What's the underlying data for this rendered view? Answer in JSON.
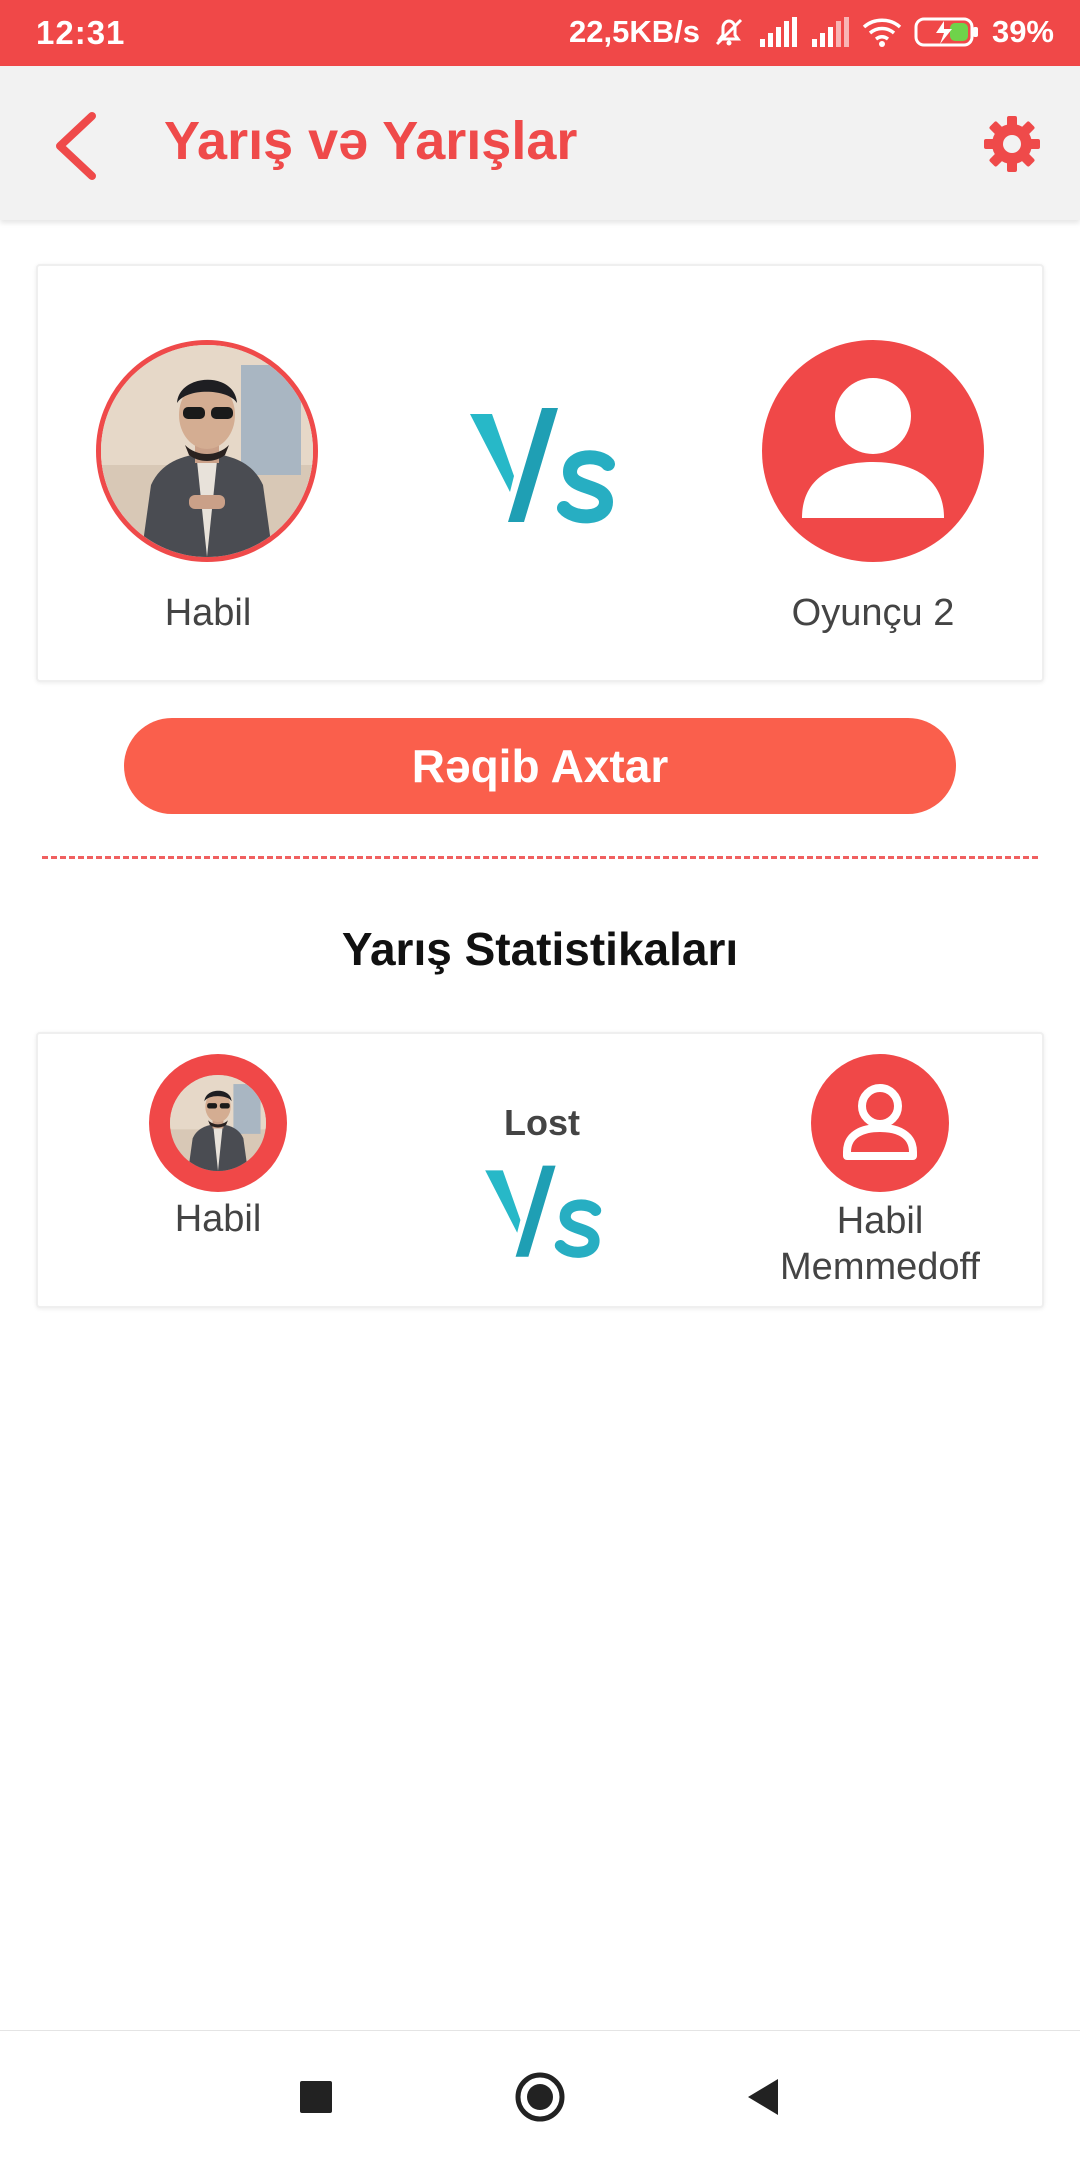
{
  "status_bar": {
    "time": "12:31",
    "network_speed": "22,5KB/s",
    "battery": "39%"
  },
  "app_bar": {
    "title": "Yarış və Yarışlar",
    "back_icon": "chevron-left-icon",
    "settings_icon": "gear-icon"
  },
  "match": {
    "player1_name": "Habil",
    "player2_name": "Oyunçu 2",
    "vs_text": "VS"
  },
  "search_button": {
    "label": "Rəqib Axtar"
  },
  "stats": {
    "title": "Yarış Statistikaları",
    "items": [
      {
        "player1_name": "Habil",
        "result": "Lost",
        "opponent_name": "Habil Memmedoff"
      }
    ]
  },
  "nav_bar": {
    "recents_icon": "square-icon",
    "home_icon": "circle-icon",
    "back_icon": "triangle-back-icon"
  },
  "colors": {
    "accent": "#f04848",
    "button": "#fa5f4c",
    "vs": "#2bb3c7"
  }
}
